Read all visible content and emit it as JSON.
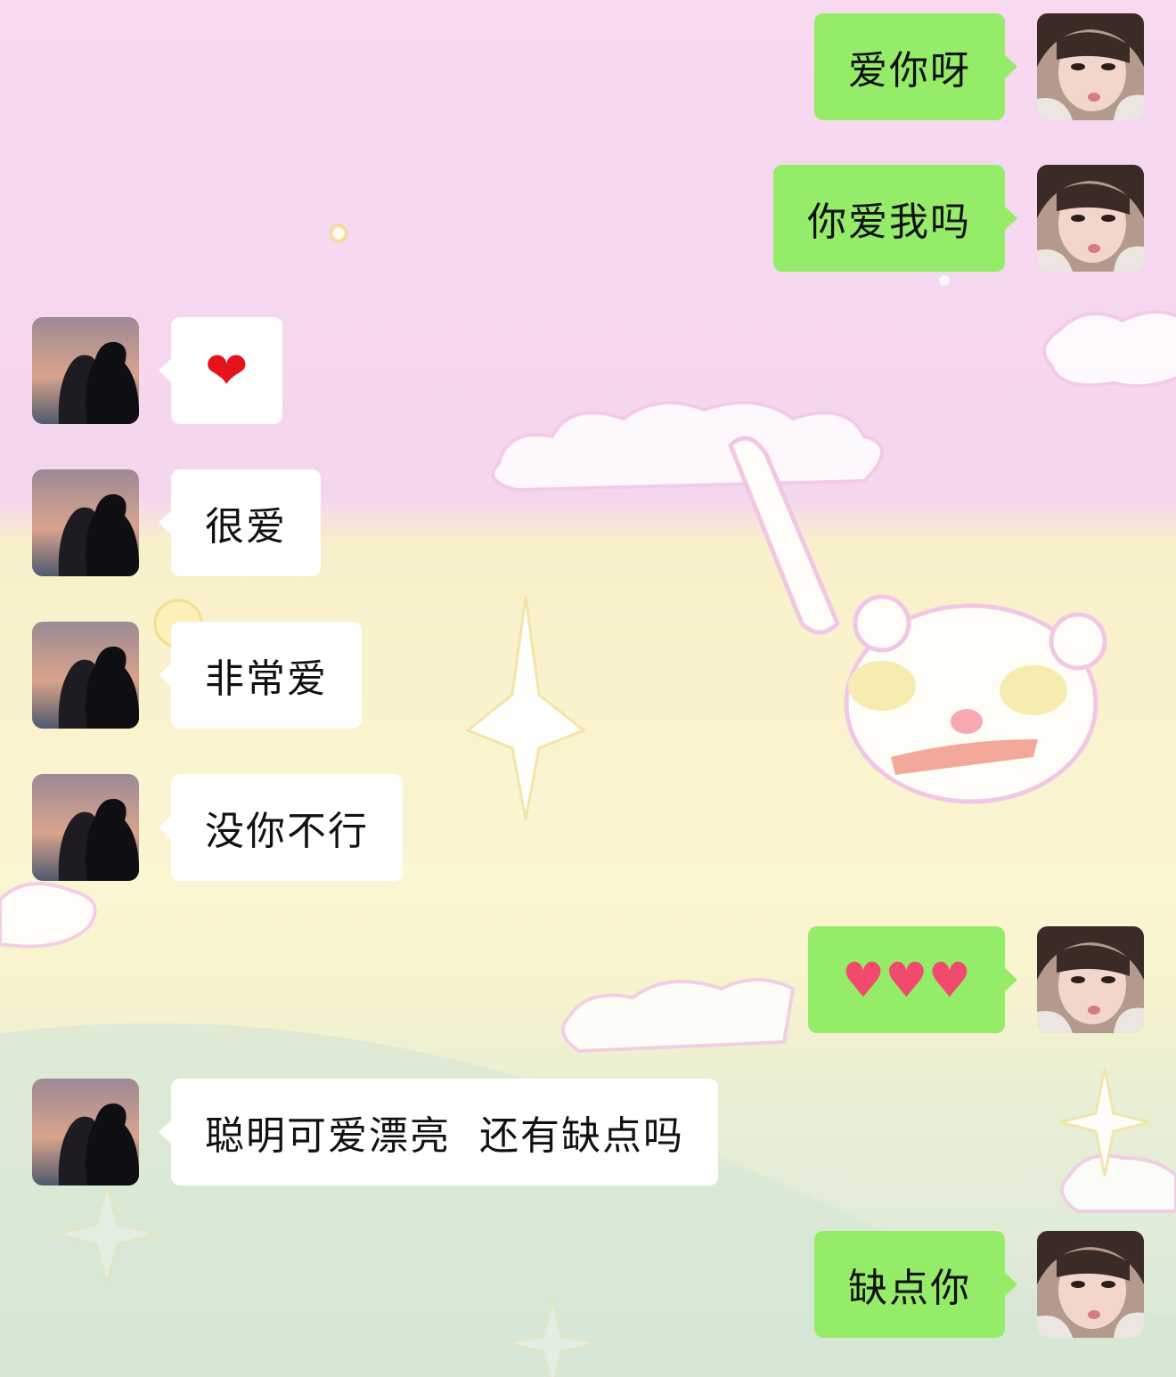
{
  "messages": [
    {
      "sender": "self",
      "text": "爱你呀"
    },
    {
      "sender": "self",
      "text": "你爱我吗"
    },
    {
      "sender": "other",
      "text": "❤"
    },
    {
      "sender": "other",
      "text": "很爱"
    },
    {
      "sender": "other",
      "text": "非常爱"
    },
    {
      "sender": "other",
      "text": "没你不行"
    },
    {
      "sender": "self",
      "text": "♥♥♥"
    },
    {
      "sender": "other",
      "text": "聪明可爱漂亮  还有缺点吗"
    },
    {
      "sender": "self",
      "text": "缺点你"
    }
  ],
  "colors": {
    "self_bubble": "#95ec69",
    "other_bubble": "#ffffff",
    "text": "#111111"
  },
  "icons": {
    "self_avatar": "girl-selfie-avatar",
    "other_avatar": "couple-kissing-avatar"
  }
}
